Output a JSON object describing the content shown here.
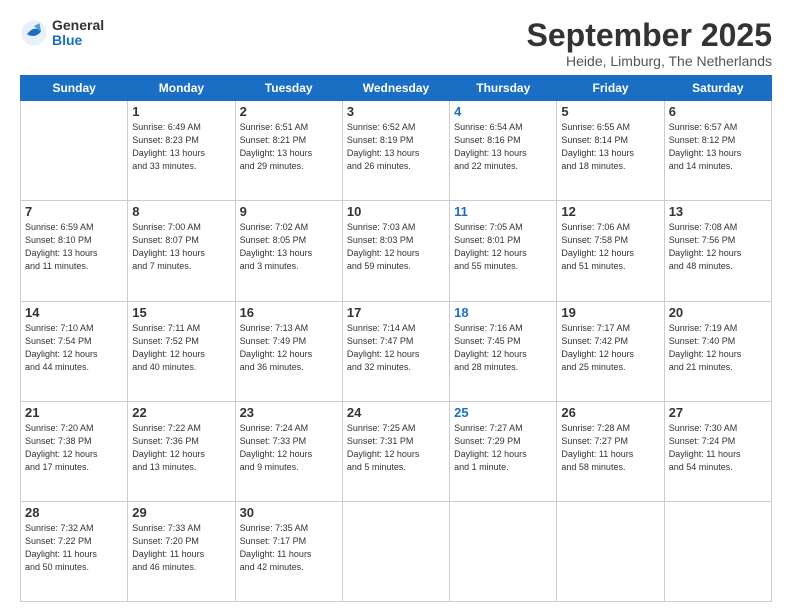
{
  "logo": {
    "general": "General",
    "blue": "Blue"
  },
  "title": "September 2025",
  "location": "Heide, Limburg, The Netherlands",
  "days_of_week": [
    "Sunday",
    "Monday",
    "Tuesday",
    "Wednesday",
    "Thursday",
    "Friday",
    "Saturday"
  ],
  "weeks": [
    [
      {
        "day": "",
        "info": ""
      },
      {
        "day": "1",
        "info": "Sunrise: 6:49 AM\nSunset: 8:23 PM\nDaylight: 13 hours\nand 33 minutes."
      },
      {
        "day": "2",
        "info": "Sunrise: 6:51 AM\nSunset: 8:21 PM\nDaylight: 13 hours\nand 29 minutes."
      },
      {
        "day": "3",
        "info": "Sunrise: 6:52 AM\nSunset: 8:19 PM\nDaylight: 13 hours\nand 26 minutes."
      },
      {
        "day": "4",
        "info": "Sunrise: 6:54 AM\nSunset: 8:16 PM\nDaylight: 13 hours\nand 22 minutes."
      },
      {
        "day": "5",
        "info": "Sunrise: 6:55 AM\nSunset: 8:14 PM\nDaylight: 13 hours\nand 18 minutes."
      },
      {
        "day": "6",
        "info": "Sunrise: 6:57 AM\nSunset: 8:12 PM\nDaylight: 13 hours\nand 14 minutes."
      }
    ],
    [
      {
        "day": "7",
        "info": "Sunrise: 6:59 AM\nSunset: 8:10 PM\nDaylight: 13 hours\nand 11 minutes."
      },
      {
        "day": "8",
        "info": "Sunrise: 7:00 AM\nSunset: 8:07 PM\nDaylight: 13 hours\nand 7 minutes."
      },
      {
        "day": "9",
        "info": "Sunrise: 7:02 AM\nSunset: 8:05 PM\nDaylight: 13 hours\nand 3 minutes."
      },
      {
        "day": "10",
        "info": "Sunrise: 7:03 AM\nSunset: 8:03 PM\nDaylight: 12 hours\nand 59 minutes."
      },
      {
        "day": "11",
        "info": "Sunrise: 7:05 AM\nSunset: 8:01 PM\nDaylight: 12 hours\nand 55 minutes."
      },
      {
        "day": "12",
        "info": "Sunrise: 7:06 AM\nSunset: 7:58 PM\nDaylight: 12 hours\nand 51 minutes."
      },
      {
        "day": "13",
        "info": "Sunrise: 7:08 AM\nSunset: 7:56 PM\nDaylight: 12 hours\nand 48 minutes."
      }
    ],
    [
      {
        "day": "14",
        "info": "Sunrise: 7:10 AM\nSunset: 7:54 PM\nDaylight: 12 hours\nand 44 minutes."
      },
      {
        "day": "15",
        "info": "Sunrise: 7:11 AM\nSunset: 7:52 PM\nDaylight: 12 hours\nand 40 minutes."
      },
      {
        "day": "16",
        "info": "Sunrise: 7:13 AM\nSunset: 7:49 PM\nDaylight: 12 hours\nand 36 minutes."
      },
      {
        "day": "17",
        "info": "Sunrise: 7:14 AM\nSunset: 7:47 PM\nDaylight: 12 hours\nand 32 minutes."
      },
      {
        "day": "18",
        "info": "Sunrise: 7:16 AM\nSunset: 7:45 PM\nDaylight: 12 hours\nand 28 minutes."
      },
      {
        "day": "19",
        "info": "Sunrise: 7:17 AM\nSunset: 7:42 PM\nDaylight: 12 hours\nand 25 minutes."
      },
      {
        "day": "20",
        "info": "Sunrise: 7:19 AM\nSunset: 7:40 PM\nDaylight: 12 hours\nand 21 minutes."
      }
    ],
    [
      {
        "day": "21",
        "info": "Sunrise: 7:20 AM\nSunset: 7:38 PM\nDaylight: 12 hours\nand 17 minutes."
      },
      {
        "day": "22",
        "info": "Sunrise: 7:22 AM\nSunset: 7:36 PM\nDaylight: 12 hours\nand 13 minutes."
      },
      {
        "day": "23",
        "info": "Sunrise: 7:24 AM\nSunset: 7:33 PM\nDaylight: 12 hours\nand 9 minutes."
      },
      {
        "day": "24",
        "info": "Sunrise: 7:25 AM\nSunset: 7:31 PM\nDaylight: 12 hours\nand 5 minutes."
      },
      {
        "day": "25",
        "info": "Sunrise: 7:27 AM\nSunset: 7:29 PM\nDaylight: 12 hours\nand 1 minute."
      },
      {
        "day": "26",
        "info": "Sunrise: 7:28 AM\nSunset: 7:27 PM\nDaylight: 11 hours\nand 58 minutes."
      },
      {
        "day": "27",
        "info": "Sunrise: 7:30 AM\nSunset: 7:24 PM\nDaylight: 11 hours\nand 54 minutes."
      }
    ],
    [
      {
        "day": "28",
        "info": "Sunrise: 7:32 AM\nSunset: 7:22 PM\nDaylight: 11 hours\nand 50 minutes."
      },
      {
        "day": "29",
        "info": "Sunrise: 7:33 AM\nSunset: 7:20 PM\nDaylight: 11 hours\nand 46 minutes."
      },
      {
        "day": "30",
        "info": "Sunrise: 7:35 AM\nSunset: 7:17 PM\nDaylight: 11 hours\nand 42 minutes."
      },
      {
        "day": "",
        "info": ""
      },
      {
        "day": "",
        "info": ""
      },
      {
        "day": "",
        "info": ""
      },
      {
        "day": "",
        "info": ""
      }
    ]
  ]
}
